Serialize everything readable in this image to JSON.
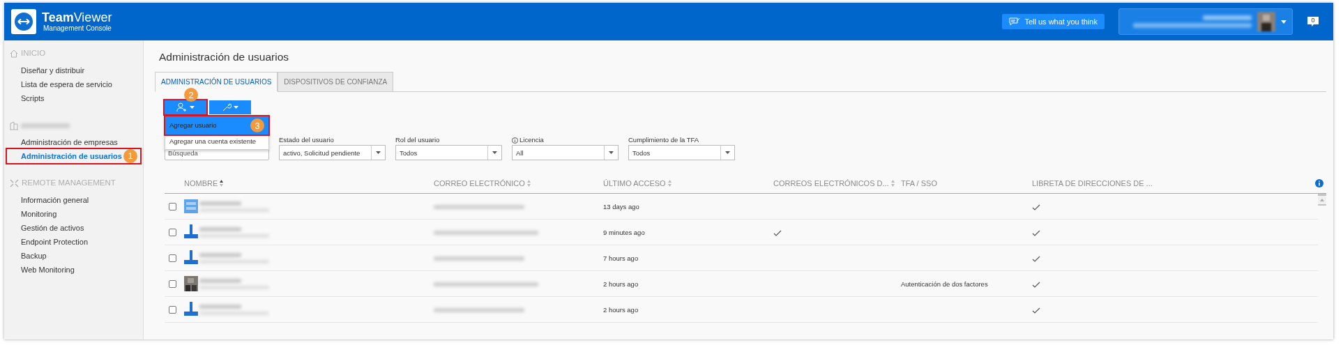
{
  "header": {
    "brand_bold": "Team",
    "brand_rest": "Viewer",
    "brand_subtitle": "Management Console",
    "feedback_button": "Tell us what you think",
    "notification_count": "0"
  },
  "sidebar": {
    "sections": [
      {
        "kind": "home",
        "title": "INICIO",
        "items": [
          {
            "label": "Diseñar y distribuir",
            "selected": false
          },
          {
            "label": "Lista de espera de servicio",
            "selected": false
          },
          {
            "label": "Scripts",
            "selected": false
          }
        ]
      },
      {
        "kind": "company",
        "items": [
          {
            "label": "Administración de empresas",
            "selected": false
          },
          {
            "label": "Administración de usuarios",
            "selected": true,
            "marker": "1"
          }
        ]
      },
      {
        "kind": "remote",
        "title": "REMOTE MANAGEMENT",
        "items": [
          {
            "label": "Información general",
            "selected": false
          },
          {
            "label": "Monitoring",
            "selected": false
          },
          {
            "label": "Gestión de activos",
            "selected": false
          },
          {
            "label": "Endpoint Protection",
            "selected": false
          },
          {
            "label": "Backup",
            "selected": false
          },
          {
            "label": "Web Monitoring",
            "selected": false
          }
        ]
      }
    ]
  },
  "page_title": "Administración de usuarios",
  "tabs": [
    {
      "label": "ADMINISTRACIÓN DE USUARIOS",
      "selected": true
    },
    {
      "label": "DISPOSITIVOS DE CONFIANZA",
      "selected": false
    }
  ],
  "toolbar": {
    "buttons": [
      {
        "kind": "add-user",
        "marker": "2"
      },
      {
        "kind": "tools"
      }
    ],
    "menu": [
      {
        "label": "Agregar usuario",
        "selected": true,
        "marker": "3"
      },
      {
        "label": "Agregar una cuenta existente",
        "selected": false
      }
    ]
  },
  "filters": {
    "search": {
      "placeholder": "Búsqueda"
    },
    "selects": [
      {
        "label": "Estado del usuario",
        "value": "activo, Solicitud pendiente"
      },
      {
        "label": "Rol del usuario",
        "value": "Todos"
      },
      {
        "label": "Licencia",
        "value": "All",
        "info": true
      },
      {
        "label": "Cumplimiento de la TFA",
        "value": "Todos"
      }
    ]
  },
  "table": {
    "columns": [
      {
        "label": "NOMBRE",
        "kind": "sorted"
      },
      {
        "label": "CORREO ELECTRÓNICO",
        "kind": "sortable"
      },
      {
        "label": "ÚLTIMO ACCESO",
        "kind": "sortable"
      },
      {
        "label": "CORREOS ELECTRÓNICOS D...",
        "kind": "sortable"
      },
      {
        "label": "TFA / SSO",
        "kind": "plain"
      },
      {
        "label": "LIBRETA DE DIRECCIONES DE ...",
        "kind": "plain"
      }
    ],
    "rows": [
      {
        "checked": false,
        "kind": "group",
        "last_access": "13 days ago",
        "emails": false,
        "address_book": true
      },
      {
        "checked": false,
        "kind": "user",
        "last_access": "9 minutes ago",
        "emails": true,
        "address_book": true
      },
      {
        "checked": false,
        "kind": "user",
        "last_access": "7 hours ago",
        "emails": false,
        "address_book": true
      },
      {
        "checked": false,
        "last_access": "2 hours ago",
        "emails": false,
        "tfa": "Autenticación de dos factores",
        "address_book": true
      },
      {
        "checked": false,
        "kind": "user",
        "last_access": "2 hours ago",
        "emails": false,
        "address_book": true
      }
    ]
  }
}
